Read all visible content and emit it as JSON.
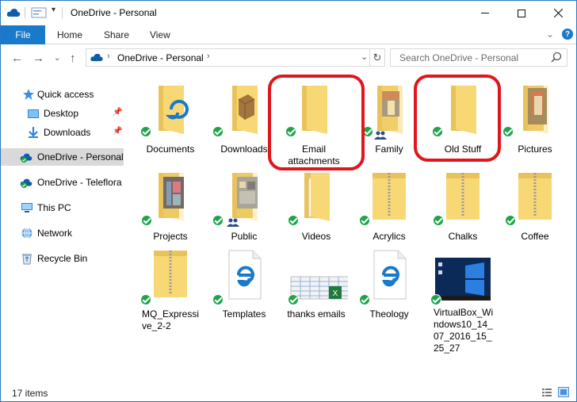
{
  "window": {
    "title": "OneDrive - Personal"
  },
  "ribbon": {
    "file": "File",
    "home": "Home",
    "share": "Share",
    "view": "View"
  },
  "address": {
    "crumb": "OneDrive - Personal"
  },
  "search": {
    "placeholder": "Search OneDrive - Personal"
  },
  "nav": {
    "items": [
      {
        "label": "Quick access",
        "icon": "star-icon"
      },
      {
        "label": "Desktop",
        "icon": "desktop-folder-icon",
        "pinned": true
      },
      {
        "label": "Downloads",
        "icon": "downloads-icon",
        "pinned": true
      },
      {
        "label": "OneDrive - Personal",
        "icon": "onedrive-icon",
        "selected": true
      },
      {
        "label": "OneDrive - Teleflora",
        "icon": "onedrive-icon"
      },
      {
        "label": "This PC",
        "icon": "pc-icon"
      },
      {
        "label": "Network",
        "icon": "network-icon"
      },
      {
        "label": "Recycle Bin",
        "icon": "recycle-bin-icon"
      }
    ]
  },
  "files": [
    {
      "name": "Documents",
      "type": "folder-edge"
    },
    {
      "name": "Downloads",
      "type": "folder-boxes"
    },
    {
      "name": "Email attachments",
      "type": "folder"
    },
    {
      "name": "Family",
      "type": "folder-photo-shared"
    },
    {
      "name": "Old Stuff",
      "type": "folder"
    },
    {
      "name": "Pictures",
      "type": "folder-photo"
    },
    {
      "name": "Projects",
      "type": "folder-photo"
    },
    {
      "name": "Public",
      "type": "folder-shared"
    },
    {
      "name": "Videos",
      "type": "folder"
    },
    {
      "name": "Acrylics",
      "type": "zip"
    },
    {
      "name": "Chalks",
      "type": "zip"
    },
    {
      "name": "Coffee",
      "type": "zip"
    },
    {
      "name": "MQ_Expressive_2-2",
      "type": "zip"
    },
    {
      "name": "Templates",
      "type": "edge-doc"
    },
    {
      "name": "thanks emails",
      "type": "excel"
    },
    {
      "name": "Theology",
      "type": "edge-doc"
    },
    {
      "name": "VirtualBox_Windows10_14_07_2016_15_25_27",
      "type": "screenshot"
    }
  ],
  "highlighted": [
    "Email attachments",
    "Old Stuff"
  ],
  "status": {
    "count": "17 items"
  },
  "colors": {
    "accent": "#1979ca",
    "sync_ok": "#1ea44a",
    "annotation": "#e0161d",
    "folder": "#f8d775"
  }
}
